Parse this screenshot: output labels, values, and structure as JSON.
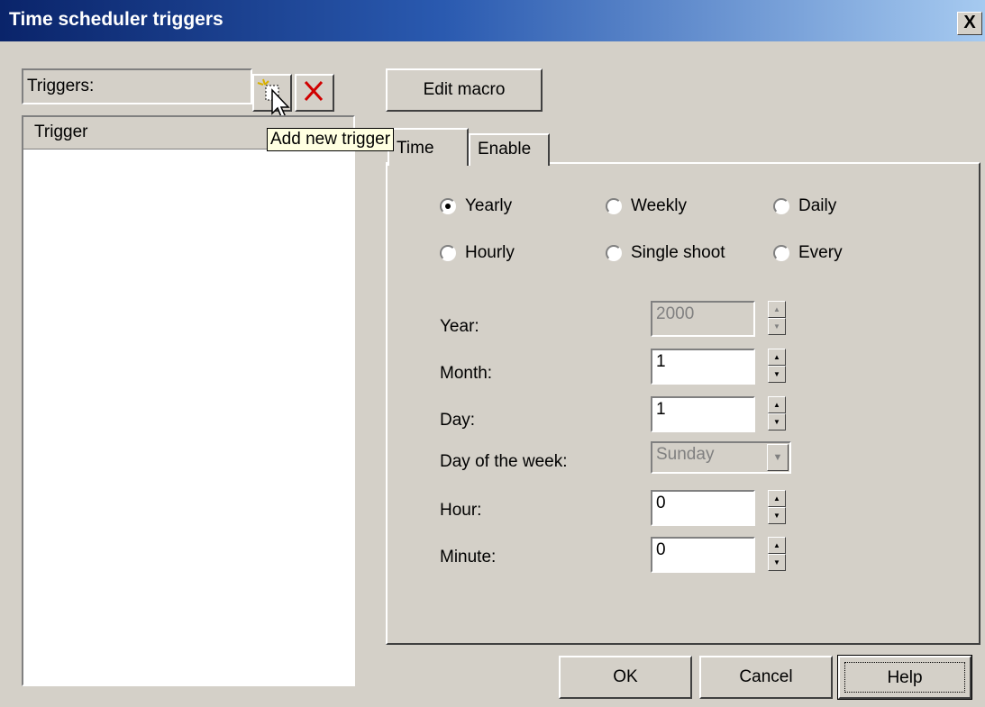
{
  "window": {
    "title": "Time scheduler triggers",
    "close_label": "X"
  },
  "triggers": {
    "label": "Triggers:",
    "list_header": "Trigger",
    "add_tooltip": "Add new trigger"
  },
  "edit_macro_label": "Edit macro",
  "tabs": [
    {
      "label": "Time"
    },
    {
      "label": "Enable"
    }
  ],
  "schedule": {
    "selected": "Yearly",
    "options": [
      "Yearly",
      "Weekly",
      "Daily",
      "Hourly",
      "Single shoot",
      "Every"
    ]
  },
  "fields": {
    "year": {
      "label": "Year:",
      "value": "2000"
    },
    "month": {
      "label": "Month:",
      "value": "1"
    },
    "day": {
      "label": "Day:",
      "value": "1"
    },
    "day_of_week": {
      "label": "Day of the week:",
      "value": "Sunday"
    },
    "hour": {
      "label": "Hour:",
      "value": "0"
    },
    "minute": {
      "label": "Minute:",
      "value": "0"
    }
  },
  "buttons": {
    "ok": "OK",
    "cancel": "Cancel",
    "help": "Help"
  }
}
